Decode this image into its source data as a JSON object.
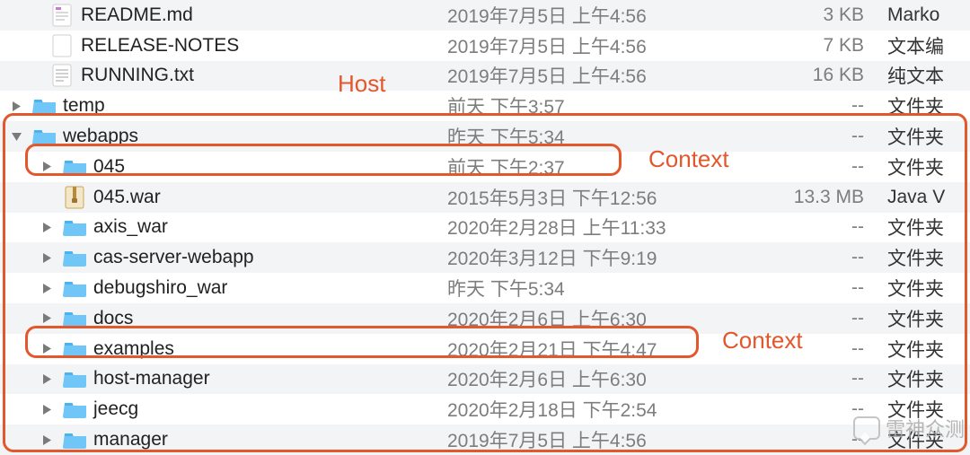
{
  "annotations": {
    "host_label": "Host",
    "context_label_1": "Context",
    "context_label_2": "Context"
  },
  "watermark": "雷神众测",
  "colors": {
    "annotation": "#e2572c",
    "row_even": "#f2f4f6",
    "row_odd": "#ffffff",
    "folder": "#59c1f8",
    "muted_text": "#7d7d7d"
  },
  "rows": [
    {
      "indent": 1,
      "disclosure": "none",
      "icon": "md-file",
      "name": "README.md",
      "date": "2019年7月5日 上午4:56",
      "size": "3 KB",
      "kind": "Marko"
    },
    {
      "indent": 1,
      "disclosure": "none",
      "icon": "blank-file",
      "name": "RELEASE-NOTES",
      "date": "2019年7月5日 上午4:56",
      "size": "7 KB",
      "kind": "文本编"
    },
    {
      "indent": 1,
      "disclosure": "none",
      "icon": "txt-file",
      "name": "RUNNING.txt",
      "date": "2019年7月5日 上午4:56",
      "size": "16 KB",
      "kind": "纯文本"
    },
    {
      "indent": 1,
      "disclosure": "right",
      "icon": "folder",
      "name": "temp",
      "date": "前天 下午3:57",
      "size": "--",
      "kind": "文件夹"
    },
    {
      "indent": 1,
      "disclosure": "down",
      "icon": "folder",
      "name": "webapps",
      "date": "昨天 下午5:34",
      "size": "--",
      "kind": "文件夹"
    },
    {
      "indent": 2,
      "disclosure": "right",
      "icon": "folder",
      "name": "045",
      "date": "前天 下午2:37",
      "size": "--",
      "kind": "文件夹"
    },
    {
      "indent": 2,
      "disclosure": "none",
      "icon": "archive",
      "name": "045.war",
      "date": "2015年5月3日 下午12:56",
      "size": "13.3 MB",
      "kind": "Java V"
    },
    {
      "indent": 2,
      "disclosure": "right",
      "icon": "folder",
      "name": "axis_war",
      "date": "2020年2月28日 上午11:33",
      "size": "--",
      "kind": "文件夹"
    },
    {
      "indent": 2,
      "disclosure": "right",
      "icon": "folder",
      "name": "cas-server-webapp",
      "date": "2020年3月12日 下午9:19",
      "size": "--",
      "kind": "文件夹"
    },
    {
      "indent": 2,
      "disclosure": "right",
      "icon": "folder",
      "name": "debugshiro_war",
      "date": "昨天 下午5:34",
      "size": "--",
      "kind": "文件夹"
    },
    {
      "indent": 2,
      "disclosure": "right",
      "icon": "folder",
      "name": "docs",
      "date": "2020年2月6日 上午6:30",
      "size": "--",
      "kind": "文件夹"
    },
    {
      "indent": 2,
      "disclosure": "right",
      "icon": "folder",
      "name": "examples",
      "date": "2020年2月21日 下午4:47",
      "size": "--",
      "kind": "文件夹"
    },
    {
      "indent": 2,
      "disclosure": "right",
      "icon": "folder",
      "name": "host-manager",
      "date": "2020年2月6日 上午6:30",
      "size": "--",
      "kind": "文件夹"
    },
    {
      "indent": 2,
      "disclosure": "right",
      "icon": "folder",
      "name": "jeecg",
      "date": "2020年2月18日 下午2:54",
      "size": "--",
      "kind": "文件夹"
    },
    {
      "indent": 2,
      "disclosure": "right",
      "icon": "folder",
      "name": "manager",
      "date": "2019年7月5日 上午4:56",
      "size": "--",
      "kind": "文件夹"
    }
  ]
}
